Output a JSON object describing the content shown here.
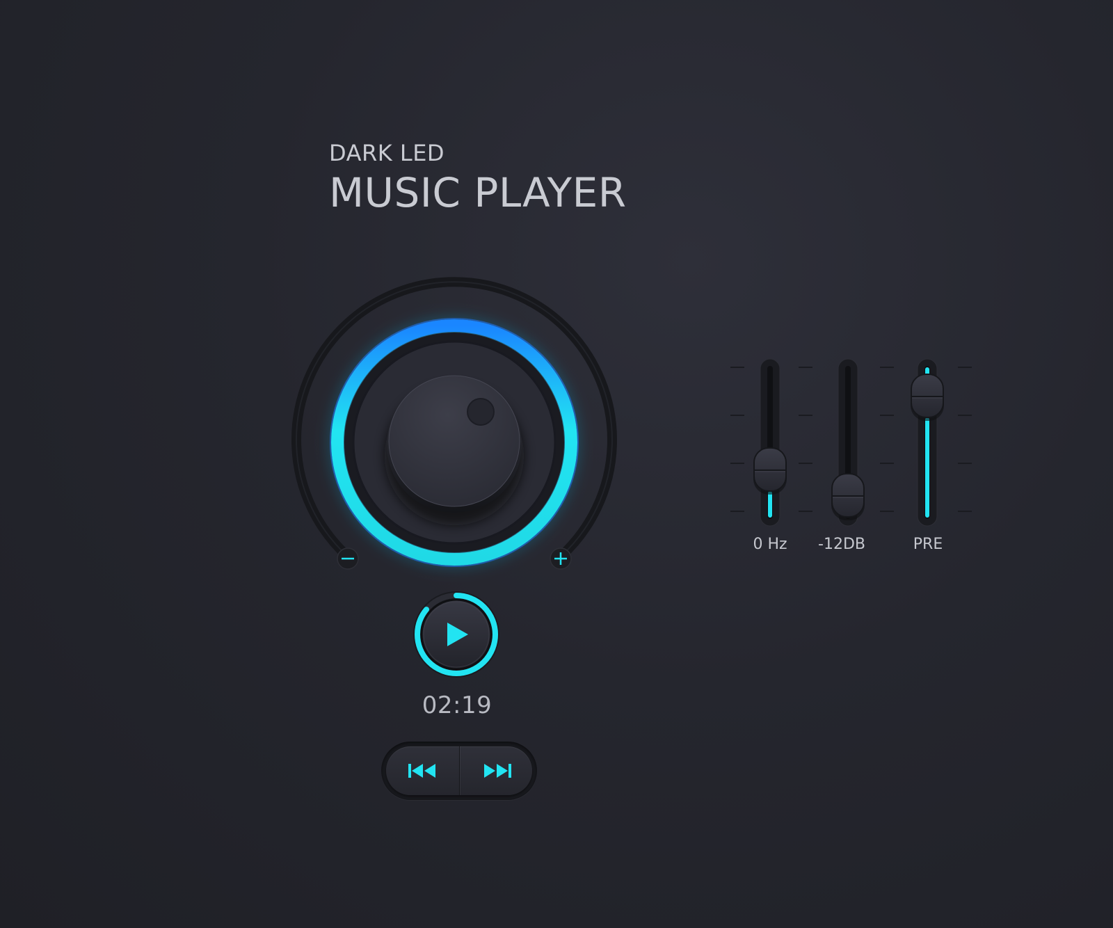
{
  "header": {
    "subtitle": "DARK LED",
    "title": "MUSIC PLAYER"
  },
  "colors": {
    "accent": "#22e4f2",
    "accent_blue": "#1a8cff",
    "background": "#25262e",
    "text": "#c9cbd2"
  },
  "volume_knob": {
    "min_label": "–",
    "max_label": "+",
    "icon_min": "minus-icon",
    "icon_max": "plus-icon"
  },
  "player": {
    "play_icon": "play-icon",
    "time": "02:19",
    "progress": 0.86
  },
  "transport": {
    "prev_icon": "skip-previous-icon",
    "next_icon": "skip-next-icon"
  },
  "equalizer": {
    "sliders": [
      {
        "label": "0 Hz",
        "level": 0.26
      },
      {
        "label": "-12DB",
        "level": 0.0
      },
      {
        "label": "PRE",
        "level": 1.0
      }
    ]
  }
}
